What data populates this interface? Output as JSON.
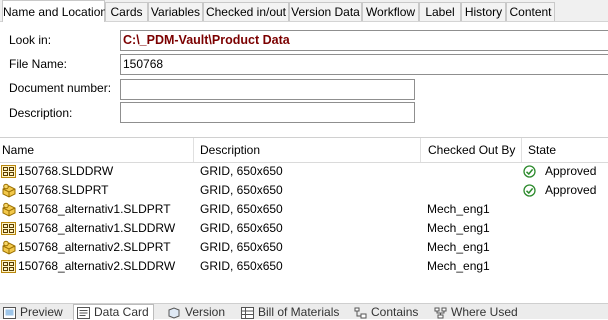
{
  "top_tabs": [
    "Name and Location",
    "Cards",
    "Variables",
    "Checked in/out",
    "Version Data",
    "Workflow",
    "Label",
    "History",
    "Content"
  ],
  "search": {
    "look_in_label": "Look in:",
    "look_in_value": "C:\\_PDM-Vault\\Product Data",
    "file_name_label": "File Name:",
    "file_name_value": "150768",
    "document_number_label": "Document number:",
    "document_number_value": "",
    "description_label": "Description:",
    "description_value": ""
  },
  "columns": [
    "Name",
    "Description",
    "Checked Out By",
    "State"
  ],
  "rows": [
    {
      "icon": "drawing-icon",
      "name": "150768.SLDDRW",
      "description": "GRID, 650x650",
      "checked_out_by": "",
      "state": "Approved"
    },
    {
      "icon": "part-icon",
      "name": "150768.SLDPRT",
      "description": "GRID, 650x650",
      "checked_out_by": "",
      "state": "Approved"
    },
    {
      "icon": "part-icon",
      "name": "150768_alternativ1.SLDPRT",
      "description": "GRID, 650x650",
      "checked_out_by": "Mech_eng1",
      "state": ""
    },
    {
      "icon": "drawing-icon",
      "name": "150768_alternativ1.SLDDRW",
      "description": "GRID, 650x650",
      "checked_out_by": "Mech_eng1",
      "state": ""
    },
    {
      "icon": "part-icon",
      "name": "150768_alternativ2.SLDPRT",
      "description": "GRID, 650x650",
      "checked_out_by": "Mech_eng1",
      "state": ""
    },
    {
      "icon": "drawing-icon",
      "name": "150768_alternativ2.SLDDRW",
      "description": "GRID, 650x650",
      "checked_out_by": "Mech_eng1",
      "state": ""
    }
  ],
  "bottom_tabs": [
    {
      "label": "Preview",
      "icon": "preview-icon"
    },
    {
      "label": "Data Card",
      "icon": "data-card-icon"
    },
    {
      "label": "Version",
      "icon": "version-icon"
    },
    {
      "label": "Bill of Materials",
      "icon": "bill-of-materials-icon"
    },
    {
      "label": "Contains",
      "icon": "contains-icon"
    },
    {
      "label": "Where Used",
      "icon": "where-used-icon"
    }
  ],
  "colors": {
    "path_text": "#7b0000",
    "approved_icon": "#2e8b2e",
    "part_icon": "#e6b422",
    "drawing_icon": "#d4a017"
  }
}
